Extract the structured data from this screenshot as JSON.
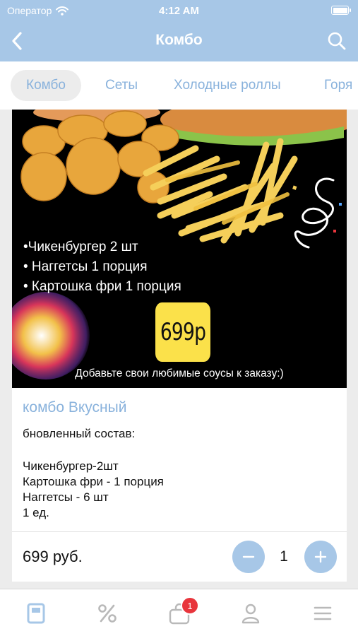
{
  "status": {
    "carrier": "Оператор",
    "time": "4:12 AM"
  },
  "nav": {
    "title": "Комбо"
  },
  "tabs": [
    {
      "label": "Комбо"
    },
    {
      "label": "Сеты"
    },
    {
      "label": "Холодные роллы"
    },
    {
      "label": "Горя"
    }
  ],
  "promo": {
    "lines": [
      "•Чикенбургер 2 шт",
      "• Наггетсы 1 порция",
      "• Картошка фри 1 порция"
    ],
    "price": "699р",
    "note": "Добавьте свои любимые соусы к заказу:)"
  },
  "product": {
    "name": "комбо Вкусный",
    "description": [
      "бновленный состав:",
      "",
      "Чикенбургер-2шт",
      "Картошка фри - 1 порция",
      "Наггетсы - 6 шт",
      "1 ед."
    ],
    "price": "699 руб.",
    "quantity": "1"
  },
  "tabbar": {
    "items": [
      "menu-icon",
      "percent-icon",
      "cart-icon",
      "profile-icon",
      "hamburger-icon"
    ],
    "cart_badge": "1"
  },
  "colors": {
    "accent": "#a7c7e7",
    "accent_text": "#89b2dc",
    "badge": "#e8353c",
    "price_badge": "#fbe14a"
  }
}
